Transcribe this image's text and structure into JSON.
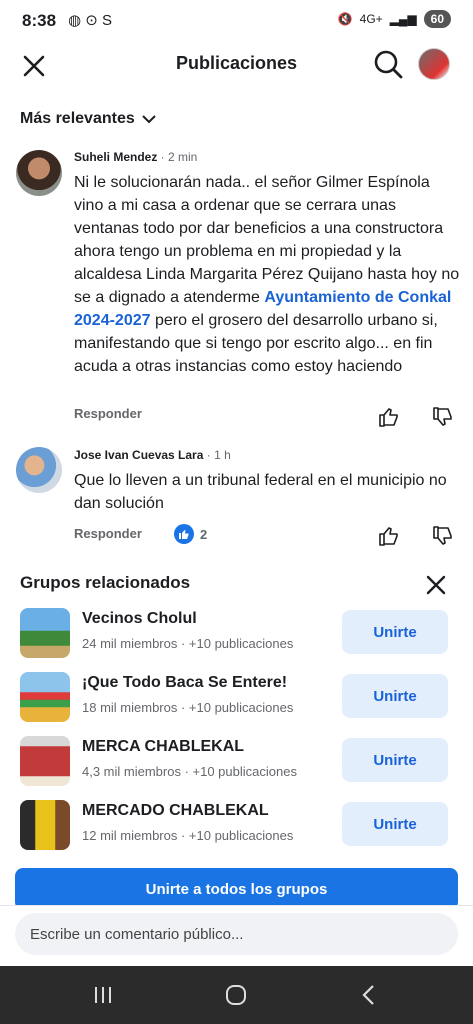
{
  "status_bar": {
    "time": "8:38",
    "app_icons": "◍ ⊙ S",
    "network": "4G+",
    "battery": "60"
  },
  "header": {
    "title": "Publicaciones"
  },
  "sort": {
    "label": "Más relevantes"
  },
  "comments": [
    {
      "author": "Suheli Mendez",
      "time": " · 2 min",
      "text_before": "Ni le solucionarán nada.. el señor Gilmer Espínola vino a mi casa a ordenar que se cerrara unas ventanas todo por dar beneficios a una constructora ahora tengo un problema en mi propiedad y la alcaldesa Linda Margarita Pérez Quijano hasta hoy no se a dignado a atenderme ",
      "mention": "Ayuntamiento de Conkal 2024-2027",
      "text_after": " pero el grosero del desarrollo urbano si, manifestando que si tengo por escrito algo... en fin acuda a otras instancias como estoy haciendo",
      "reply_label": "Responder"
    },
    {
      "author": "Jose Ivan Cuevas Lara",
      "time": " · 1 h",
      "text": "Que lo lleven a un tribunal federal en el municipio no dan solución",
      "reply_label": "Responder",
      "reaction_count": "2"
    }
  ],
  "groups": {
    "title": "Grupos relacionados",
    "items": [
      {
        "name": "Vecinos Cholul",
        "meta": "24 mil miembros · +10 publicaciones",
        "join": "Unirte"
      },
      {
        "name": "¡Que Todo Baca Se Entere!",
        "meta": "18 mil miembros · +10 publicaciones",
        "join": "Unirte"
      },
      {
        "name": "MERCA CHABLEKAL",
        "meta": "4,3 mil miembros · +10 publicaciones",
        "join": "Unirte"
      },
      {
        "name": "MERCADO CHABLEKAL",
        "meta": "12 mil miembros · +10 publicaciones",
        "join": "Unirte"
      }
    ],
    "join_all": "Unirte a todos los grupos"
  },
  "comment_box": {
    "placeholder": "Escribe un comentario público..."
  },
  "colors": {
    "accent": "#1b74e4",
    "link": "#1a63d6",
    "join_bg": "#e3eefc"
  }
}
